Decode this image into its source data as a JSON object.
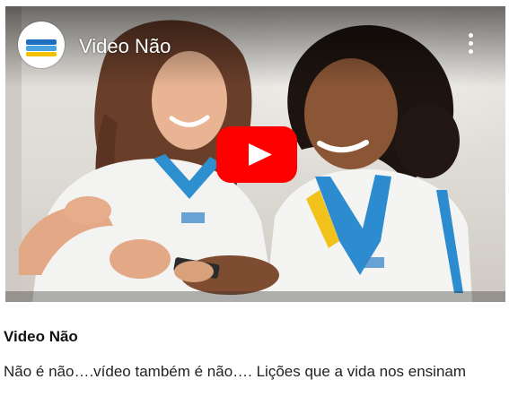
{
  "player": {
    "title": "Video Não",
    "channel_logo": "channel-logo",
    "more_icon": "vertical-ellipsis-icon",
    "play_icon": "youtube-play-icon"
  },
  "post": {
    "title": "Video Não",
    "description": "Não é não….vídeo também é não…. Lições que a vida nos ensinam"
  }
}
